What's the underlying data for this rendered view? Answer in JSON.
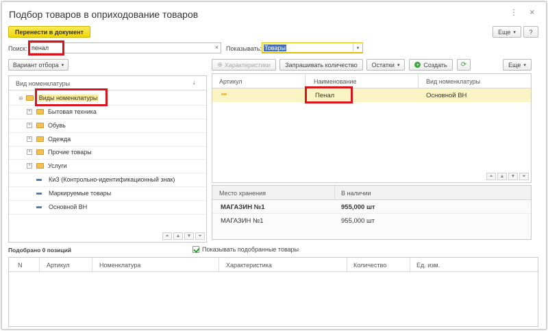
{
  "window": {
    "title": "Подбор товаров в оприходование товаров",
    "menu_label": "⋮",
    "close_label": "×"
  },
  "toolbar": {
    "transfer_label": "Перенести в документ",
    "more_label": "Еще"
  },
  "search": {
    "label": "Поиск:",
    "value": "пенал",
    "clear": "×"
  },
  "show": {
    "label": "Показывать:",
    "value": "Товары"
  },
  "filter": {
    "variant_label": "Вариант отбора"
  },
  "tree": {
    "header": "Вид номенклатуры",
    "sort_icon": "↓",
    "root": "Виды номенклатуры",
    "items": [
      {
        "label": "Бытовая техника",
        "kind": "folder"
      },
      {
        "label": "Обувь",
        "kind": "folder"
      },
      {
        "label": "Одежда",
        "kind": "folder"
      },
      {
        "label": "Прочие товары",
        "kind": "folder"
      },
      {
        "label": "Услуги",
        "kind": "folder"
      },
      {
        "label": "КиЗ  (Контрольно-идентификационный знак)",
        "kind": "item"
      },
      {
        "label": "Маркируемые товары",
        "kind": "item"
      },
      {
        "label": "Основной ВН",
        "kind": "item"
      }
    ]
  },
  "products_toolbar": {
    "characteristics": "Характеристики",
    "request_qty": "Запрашивать количество",
    "stock": "Остатки",
    "create": "Создать",
    "more": "Еще"
  },
  "products": {
    "columns": [
      "Артикул",
      "Наименование",
      "Вид номенклатуры"
    ],
    "rows": [
      {
        "article": "",
        "name": "Пенал",
        "kind": "Основной ВН"
      }
    ]
  },
  "stock": {
    "columns": [
      "Место хранения",
      "В наличии"
    ],
    "rows": [
      {
        "place": "МАГАЗИН №1",
        "qty": "955,000 шт"
      },
      {
        "place": "МАГАЗИН №1",
        "qty": "955,000 шт"
      }
    ]
  },
  "selected": {
    "count_label": "Подобрано 0 позиций",
    "show_selected_label": "Показывать подобранные товары",
    "columns": [
      "N",
      "Артикул",
      "Номенклатура",
      "Характеристика",
      "Количество",
      "Ед. изм."
    ]
  },
  "colors": {
    "highlight_row": "#fbf5c6",
    "accent_yellow": "#f3da2a",
    "red_annotation": "#d9141e"
  }
}
